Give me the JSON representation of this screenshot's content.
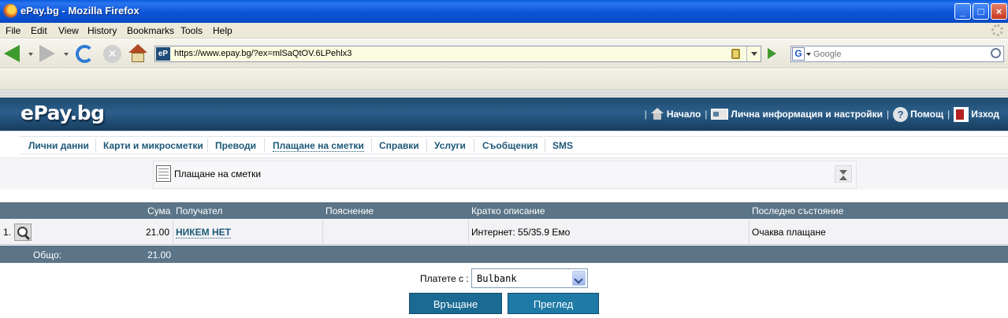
{
  "window": {
    "title": "ePay.bg - Mozilla Firefox",
    "btn_minimize": "_",
    "btn_maximize": "□",
    "btn_close": "×"
  },
  "menu": [
    "File",
    "Edit",
    "View",
    "History",
    "Bookmarks",
    "Tools",
    "Help"
  ],
  "address": {
    "favicon": "eP",
    "url": "https://www.epay.bg/?ex=mlSaQtOV.6LPehlx3"
  },
  "search": {
    "engine": "G",
    "placeholder": "Google"
  },
  "icons": {
    "back": "back-arrow-icon",
    "forward": "forward-arrow-icon",
    "reload": "reload-icon",
    "stop": "stop-icon",
    "home": "home-icon",
    "stop_glyph": "✕",
    "help_glyph": "?"
  },
  "header": {
    "logo": "ePay.bg",
    "links": {
      "home": "Начало",
      "profile": "Лична информация и настройки",
      "help": "Помощ",
      "logout": "Изход"
    },
    "separator": "|"
  },
  "tabs": [
    "Лични данни",
    "Карти и микросметки",
    "Преводи",
    "Плащане на сметки",
    "Справки",
    "Услуги",
    "Съобщения",
    "SMS"
  ],
  "active_tab": "Плащане на сметки",
  "page": {
    "title": "Плащане на сметки"
  },
  "table": {
    "headers": {
      "amount": "Сума",
      "recipient": "Получател",
      "note": "Пояснение",
      "description": "Кратко описание",
      "status": "Последно състояние"
    },
    "rows": [
      {
        "num": "1.",
        "amount": "21.00",
        "recipient": "НИКЕМ НЕТ",
        "note": "",
        "description": "Интернет: 55/35.9 Емо",
        "status": "Очаква плащане"
      }
    ],
    "footer": {
      "label": "Общо:",
      "total": "21.00"
    }
  },
  "payment": {
    "label": "Платете с :",
    "selected_bank": "Bulbank",
    "back_button": "Връщане",
    "review_button": "Преглед"
  },
  "colors": {
    "header_bg": "#2b5e8a",
    "table_header_bg": "#5b7487",
    "link": "#1d5878",
    "button_bg": "#1b6a93"
  }
}
